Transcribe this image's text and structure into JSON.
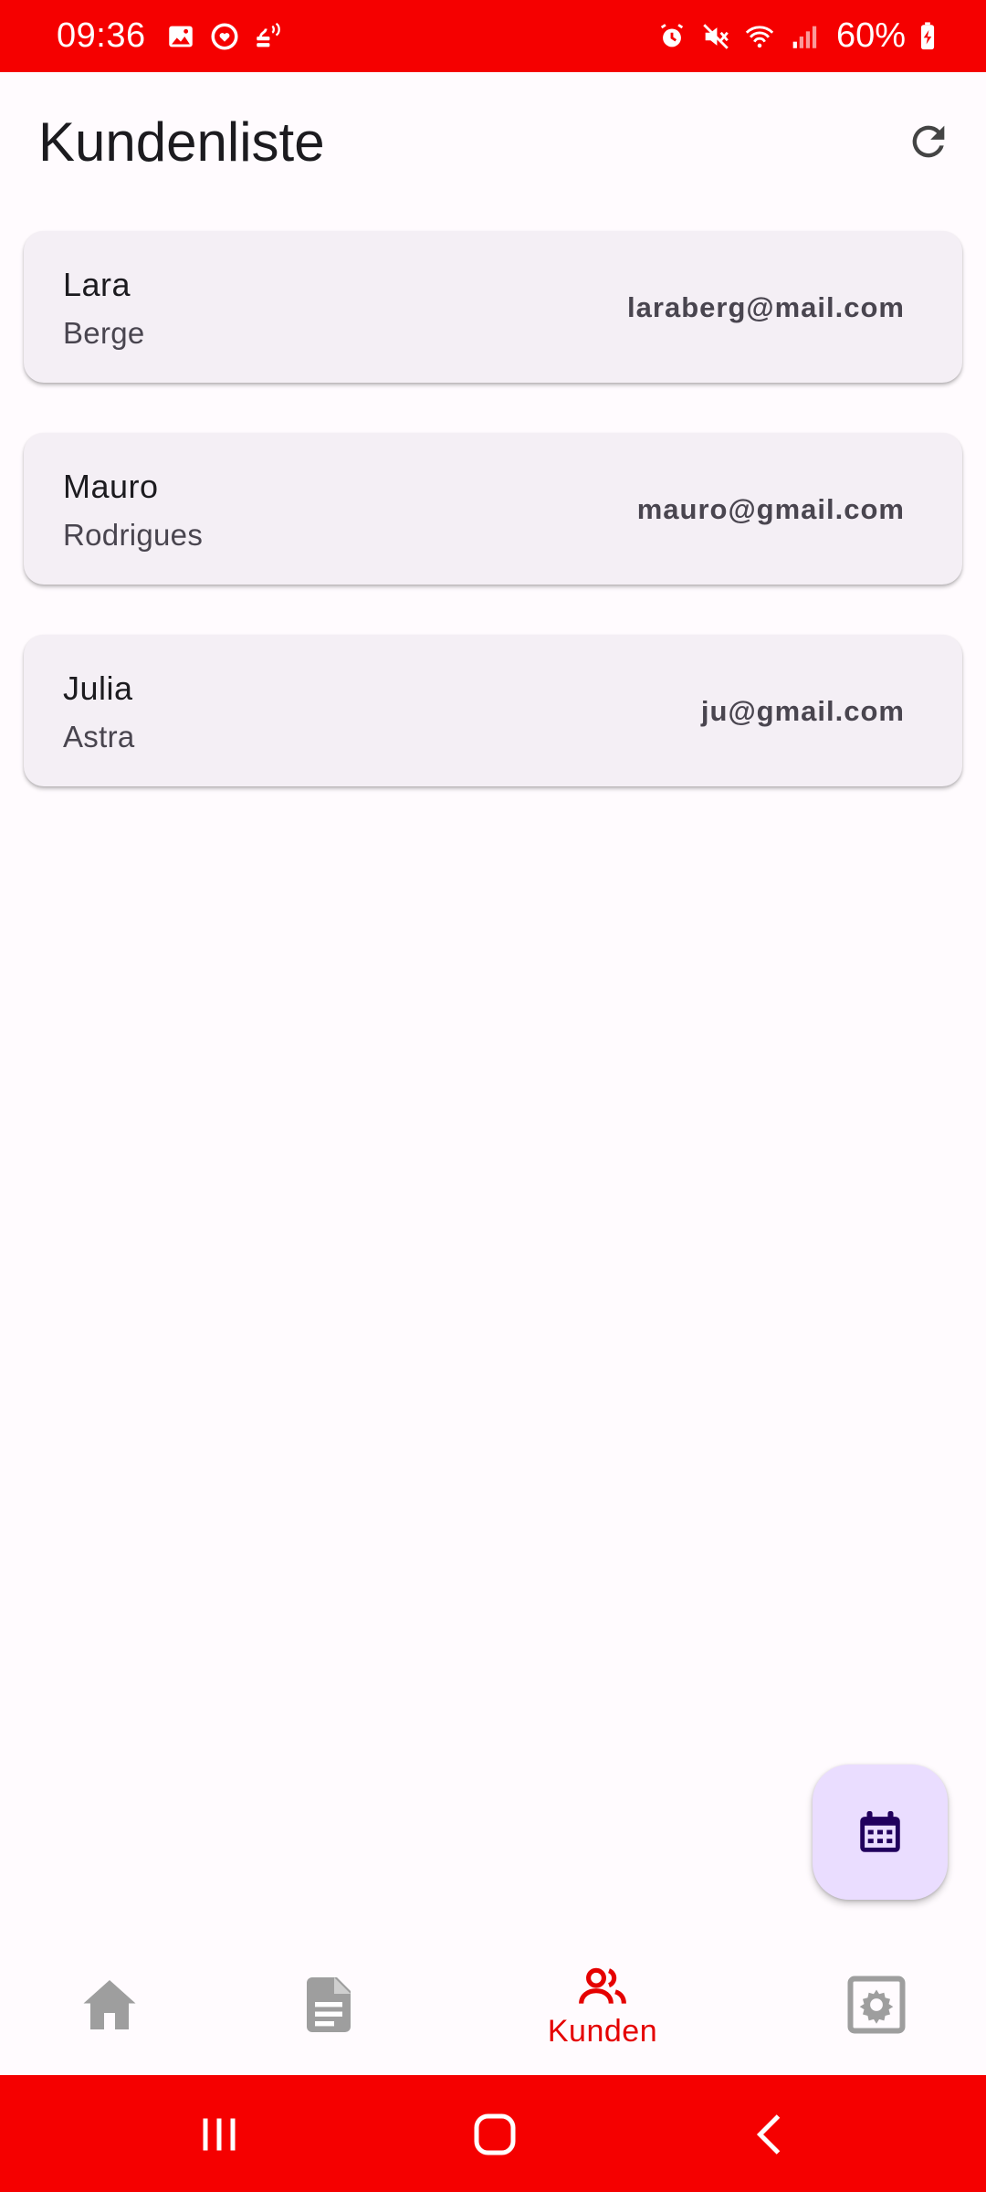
{
  "status_bar": {
    "time": "09:36",
    "battery": "60%",
    "left_icons": [
      "gallery-icon",
      "heart-sync-icon",
      "nfc-payment-icon"
    ],
    "right_icons": [
      "alarm-icon",
      "mute-icon",
      "wifi-icon",
      "signal-icon",
      "battery-icon"
    ]
  },
  "header": {
    "title": "Kundenliste",
    "action_icon": "refresh-icon"
  },
  "customers": [
    {
      "first_name": "Lara",
      "last_name": "Berge",
      "email": "laraberg@mail.com"
    },
    {
      "first_name": "Mauro",
      "last_name": "Rodrigues",
      "email": "mauro@gmail.com"
    },
    {
      "first_name": "Julia",
      "last_name": "Astra",
      "email": "ju@gmail.com"
    }
  ],
  "fab": {
    "icon": "calendar-icon"
  },
  "bottom_nav": {
    "items": [
      {
        "icon": "home-icon",
        "label": "",
        "active": false
      },
      {
        "icon": "document-icon",
        "label": "",
        "active": false
      },
      {
        "icon": "people-icon",
        "label": "Kunden",
        "active": true
      },
      {
        "icon": "settings-icon",
        "label": "",
        "active": false
      }
    ]
  },
  "system_nav": {
    "buttons": [
      "recent-apps-icon",
      "home-button-icon",
      "back-icon"
    ]
  },
  "colors": {
    "accent": "#f50000",
    "active_nav": "#e50000",
    "inactive_nav": "#9e9e9e",
    "card_background": "#f4eff5",
    "fab_background": "#eaddff",
    "fab_icon": "#21005d",
    "page_background": "#fffbfe"
  }
}
